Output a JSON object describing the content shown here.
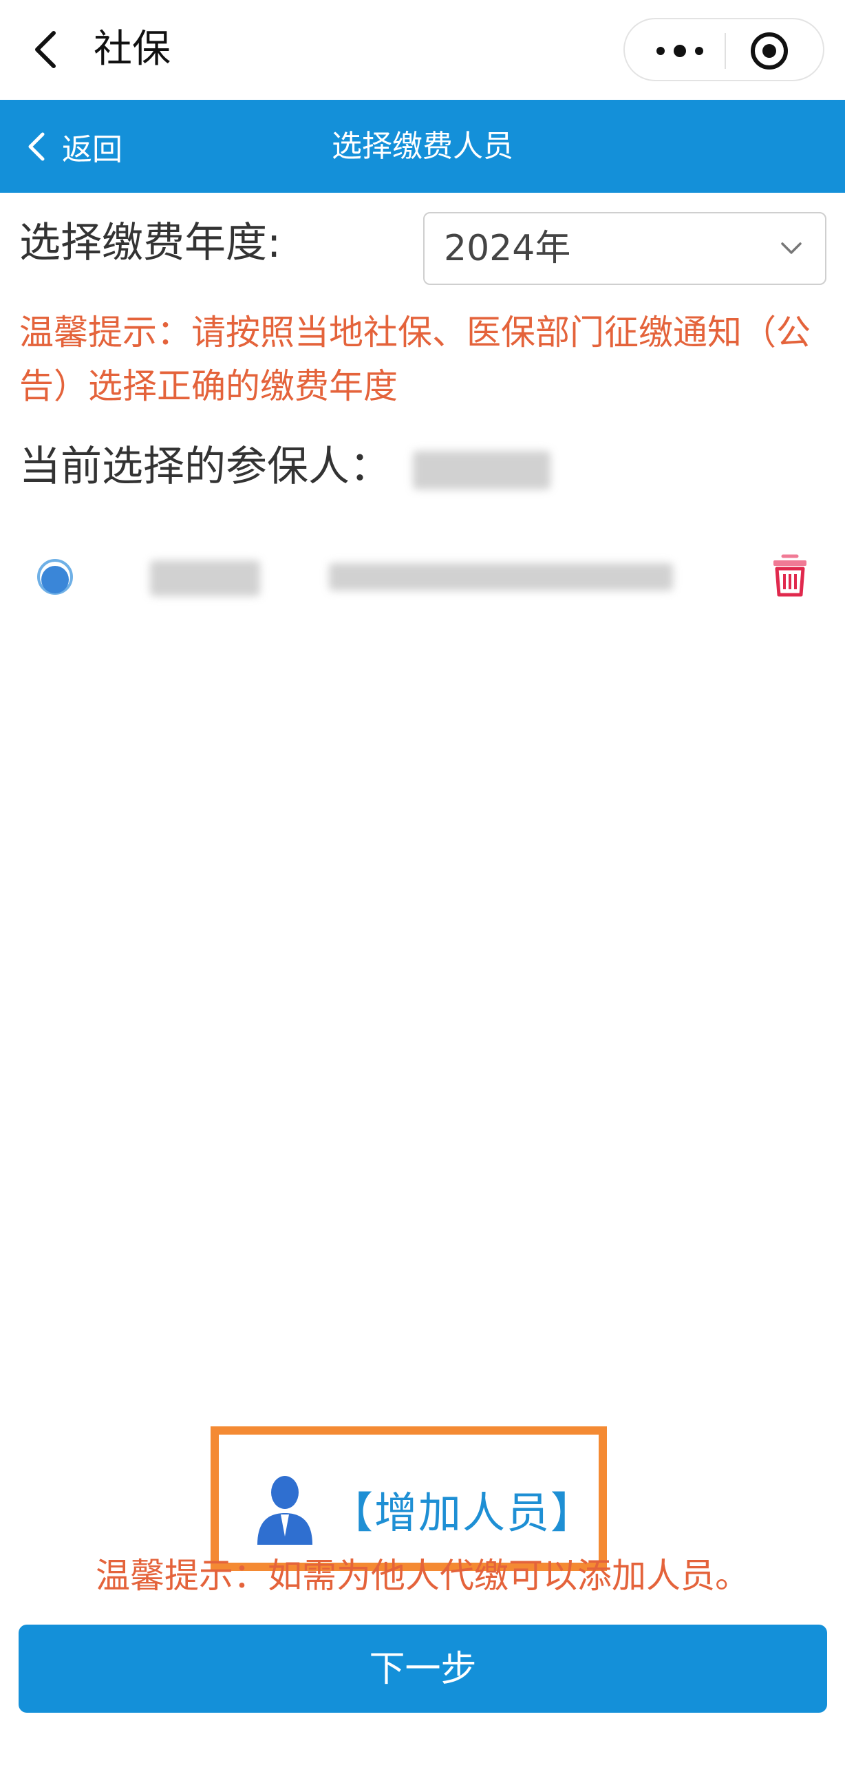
{
  "miniprogram": {
    "title": "社保"
  },
  "header": {
    "back_label": "返回",
    "title": "选择缴费人员"
  },
  "year_select": {
    "label": "选择缴费年度:",
    "value": "2024年"
  },
  "tip_top": "温馨提示：请按照当地社保、医保部门征缴通知（公告）选择正确的缴费年度",
  "current_label": "当前选择的参保人：",
  "add_person": {
    "label": "【增加人员】"
  },
  "tip_bottom": "温馨提示：如需为他人代缴可以添加人员。",
  "next_button": "下一步",
  "colors": {
    "primary": "#1490d9",
    "tip": "#e4633b",
    "highlight_box": "#f48a33",
    "trash": "#e0294d"
  }
}
